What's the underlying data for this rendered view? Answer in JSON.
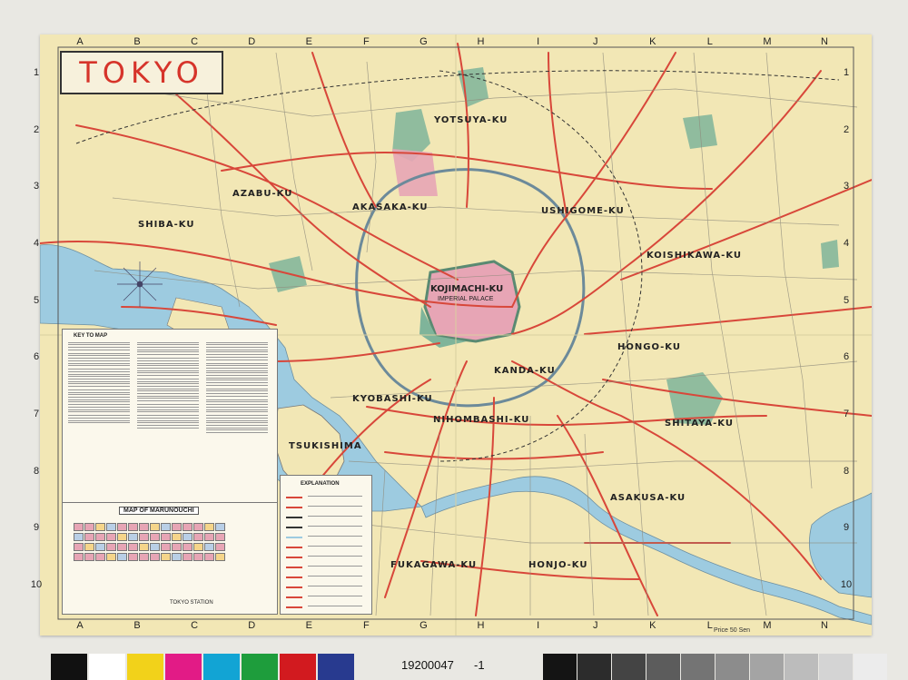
{
  "map": {
    "title": "TOKYO",
    "grid_letters": [
      "A",
      "B",
      "C",
      "D",
      "E",
      "F",
      "G",
      "H",
      "I",
      "J",
      "K",
      "L",
      "M",
      "N"
    ],
    "grid_numbers": [
      "1",
      "2",
      "3",
      "4",
      "5",
      "6",
      "7",
      "8",
      "9",
      "10"
    ],
    "wards": [
      {
        "name": "AZABU-KU"
      },
      {
        "name": "SHIBA-KU"
      },
      {
        "name": "AKASAKA-KU"
      },
      {
        "name": "YOTSUYA-KU"
      },
      {
        "name": "USHIGOME-KU"
      },
      {
        "name": "KOISHIKAWA-KU"
      },
      {
        "name": "KOJIMACHI-KU"
      },
      {
        "name": "KANDA-KU"
      },
      {
        "name": "HONGO-KU"
      },
      {
        "name": "KYOBASHI-KU"
      },
      {
        "name": "NIHOMBASHI-KU"
      },
      {
        "name": "SHITAYA-KU"
      },
      {
        "name": "TSUKISHIMA"
      },
      {
        "name": "ASAKUSA-KU"
      },
      {
        "name": "FUKAGAWA-KU"
      },
      {
        "name": "HONJO-KU"
      }
    ],
    "palace_sub_label": "IMPERIAL PALACE",
    "key_title": "KEY TO MAP",
    "marunouchi_title": "MAP OF MARUNOUCHI",
    "tokyo_station_label": "TOKYO STATION",
    "explanation_title": "EXPLANATION",
    "price": "Price 50 Sen"
  },
  "scan_strip": {
    "catalog_number": "19200047",
    "catalog_suffix": "-1",
    "color_patches": [
      "#111111",
      "#ffffff",
      "#f2d21a",
      "#e21b86",
      "#12a4d4",
      "#1e9d3c",
      "#d21a1f",
      "#283a8f"
    ]
  },
  "colors": {
    "paper": "#f2e7b5",
    "water": "#9dcbe0",
    "road": "#d8473a",
    "palace": "#e7a5b5",
    "park": "#7fb49a",
    "title_red": "#d6342a"
  }
}
